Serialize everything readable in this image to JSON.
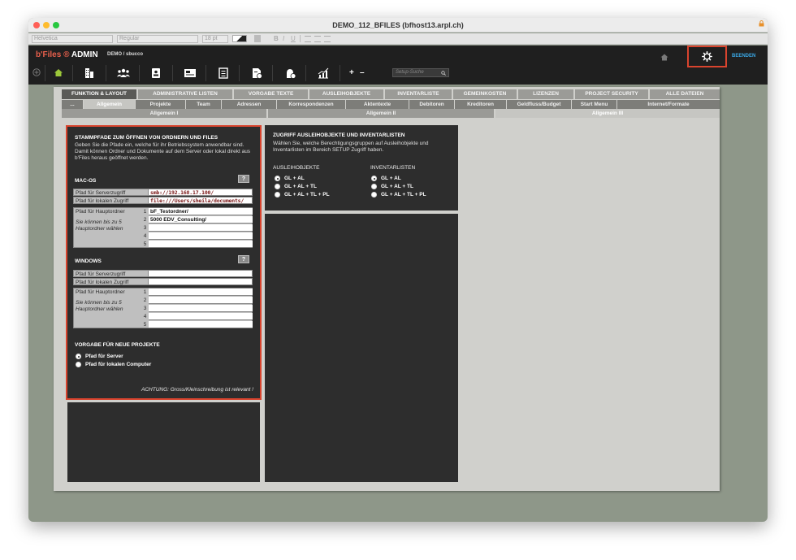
{
  "window": {
    "title": "DEMO_112_BFILES (bfhost13.arpl.ch)",
    "traffic_colors": [
      "#ff5f57",
      "#febc2e",
      "#28c840"
    ]
  },
  "format_bar": {
    "font": "Helvetica",
    "style": "Regular",
    "size": "18 pt",
    "bold": "B",
    "italic": "I",
    "underline": "U"
  },
  "app": {
    "brand_name": "b'Files",
    "brand_mark": "®",
    "brand_suffix": "ADMIN",
    "user_db": "DEMO",
    "user_sep": "/",
    "user_name": "sbucco",
    "quit_label": "BEENDEN",
    "search_placeholder": "Setup-Suche",
    "plus_label": "+",
    "minus_label": "–",
    "accent": "#d9442e",
    "quit_color": "#3aa8e6"
  },
  "tabs_row1": [
    {
      "label": "FUNKTION & LAYOUT",
      "active": true
    },
    {
      "label": "ADMINISTRATIVE LISTEN"
    },
    {
      "label": "VORGABE TEXTE"
    },
    {
      "label": "AUSLEIHOBJEKTE"
    },
    {
      "label": "INVENTARLISTE"
    },
    {
      "label": "GEMEINKOSTEN"
    },
    {
      "label": "LIZENZEN"
    },
    {
      "label": "PROJECT SECURITY"
    },
    {
      "label": "ALLE DATEIEN"
    }
  ],
  "tabs_row2": [
    {
      "label": "..."
    },
    {
      "label": "Allgemein",
      "active": true
    },
    {
      "label": "Projekte"
    },
    {
      "label": "Team"
    },
    {
      "label": "Adressen"
    },
    {
      "label": "Korrespondenzen"
    },
    {
      "label": "Aktentexte"
    },
    {
      "label": "Debitoren"
    },
    {
      "label": "Kreditoren"
    },
    {
      "label": "Geldfluss/Budget"
    },
    {
      "label": "Start Menu"
    },
    {
      "label": "Internet/Formate"
    }
  ],
  "tabs_row3": [
    {
      "label": "Allgemein I"
    },
    {
      "label": "Allgemein II"
    },
    {
      "label": "Allgemein III",
      "active": true
    }
  ],
  "paths_panel": {
    "title": "STAMMPFADE ZUM ÖFFNEN VON ORDNERN UND FILES",
    "intro": "Geben Sie die Pfade ein, welche für ihr Betriebssystem anwendbar sind. Damit können Ordner und Dokumente auf dem Server oder lokal direkt aus b'Files heraus geöffnet werden.",
    "help": "?",
    "macos": {
      "title": "MAC-OS",
      "server_label": "Pfad für Serverzugriff",
      "server_value": "smb://192.168.17.100/",
      "local_label": "Pfad für lokalen Zugriff",
      "local_value": "file:///Users/sheila/documents/",
      "main_label": "Pfad für Hauptordner",
      "main_hint": "Sie können bis zu 5 Hauptordner wählen",
      "main_folders": [
        {
          "n": "1",
          "value": "bF_Testordner/"
        },
        {
          "n": "2",
          "value": "5000 EDV_Consulting/"
        },
        {
          "n": "3",
          "value": ""
        },
        {
          "n": "4",
          "value": ""
        },
        {
          "n": "5",
          "value": ""
        }
      ]
    },
    "windows": {
      "title": "WINDOWS",
      "server_label": "Pfad für Serverzugriff",
      "server_value": "",
      "local_label": "Pfad für lokalen Zugriff",
      "local_value": "",
      "main_label": "Pfad für Hauptordner",
      "main_hint": "Sie können bis zu 5 Hauptordner wählen",
      "main_folders": [
        {
          "n": "1",
          "value": ""
        },
        {
          "n": "2",
          "value": ""
        },
        {
          "n": "3",
          "value": ""
        },
        {
          "n": "4",
          "value": ""
        },
        {
          "n": "5",
          "value": ""
        }
      ]
    },
    "new_projects": {
      "title": "VORGABE FÜR NEUE PROJEKTE",
      "opt_server": "Pfad für Server",
      "opt_local": "Pfad für lokalen Computer",
      "selected": "server"
    },
    "warning": "ACHTUNG: Gross/Kleinschreibung ist relevant !"
  },
  "access_panel": {
    "title": "ZUGRIFF AUSLEIHOBJEKTE UND INVENTARLISTEN",
    "intro": "Wählen Sie, welche Berechtigungsgruppen auf Ausleihobjekte und Inventarlisten im Bereich SETUP Zugriff haben.",
    "col1": {
      "title": "AUSLEIHOBJEKTE",
      "options": [
        "GL + AL",
        "GL + AL + TL",
        "GL + AL + TL + PL"
      ],
      "selected": 0
    },
    "col2": {
      "title": "INVENTARLISTEN",
      "options": [
        "GL + AL",
        "GL + AL + TL",
        "GL + AL + TL + PL"
      ],
      "selected": 0
    }
  }
}
